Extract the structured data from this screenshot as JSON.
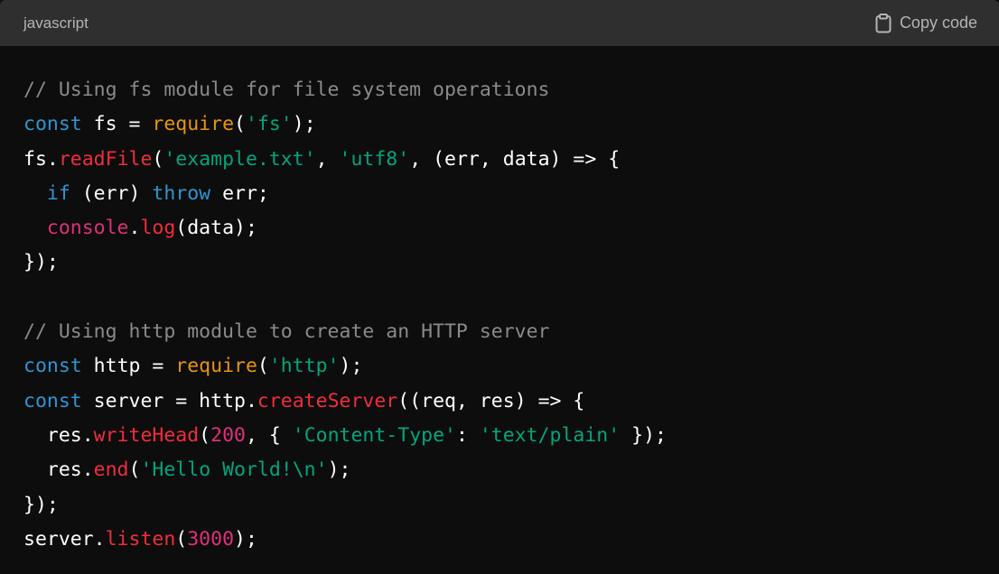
{
  "header": {
    "language": "javascript",
    "copy_label": "Copy code"
  },
  "colors": {
    "header_bg": "#2f2f2f",
    "code_bg": "#0d0d0d",
    "comment": "#8a8a8a",
    "keyword": "#2e95d3",
    "function": "#f22c3d",
    "builtin": "#e9950c",
    "string": "#00a67d",
    "number": "#df3079",
    "plain": "#ffffff"
  },
  "icons": {
    "copy": "clipboard-icon"
  },
  "code_lines": [
    [
      [
        "comment",
        "// Using fs module for file system operations"
      ]
    ],
    [
      [
        "keyword",
        "const"
      ],
      [
        "plain",
        " fs = "
      ],
      [
        "builtin",
        "require"
      ],
      [
        "plain",
        "("
      ],
      [
        "string",
        "'fs'"
      ],
      [
        "plain",
        ");"
      ]
    ],
    [
      [
        "plain",
        "fs."
      ],
      [
        "func",
        "readFile"
      ],
      [
        "plain",
        "("
      ],
      [
        "string",
        "'example.txt'"
      ],
      [
        "plain",
        ", "
      ],
      [
        "string",
        "'utf8'"
      ],
      [
        "plain",
        ", (err, data) => {"
      ]
    ],
    [
      [
        "plain",
        "  "
      ],
      [
        "keyword",
        "if"
      ],
      [
        "plain",
        " (err) "
      ],
      [
        "keyword",
        "throw"
      ],
      [
        "plain",
        " err;"
      ]
    ],
    [
      [
        "plain",
        "  "
      ],
      [
        "var",
        "console"
      ],
      [
        "plain",
        "."
      ],
      [
        "func",
        "log"
      ],
      [
        "plain",
        "(data);"
      ]
    ],
    [
      [
        "plain",
        "});"
      ]
    ],
    [
      [
        "plain",
        ""
      ]
    ],
    [
      [
        "comment",
        "// Using http module to create an HTTP server"
      ]
    ],
    [
      [
        "keyword",
        "const"
      ],
      [
        "plain",
        " http = "
      ],
      [
        "builtin",
        "require"
      ],
      [
        "plain",
        "("
      ],
      [
        "string",
        "'http'"
      ],
      [
        "plain",
        ");"
      ]
    ],
    [
      [
        "keyword",
        "const"
      ],
      [
        "plain",
        " server = http."
      ],
      [
        "func",
        "createServer"
      ],
      [
        "plain",
        "((req, res) => {"
      ]
    ],
    [
      [
        "plain",
        "  res."
      ],
      [
        "func",
        "writeHead"
      ],
      [
        "plain",
        "("
      ],
      [
        "number",
        "200"
      ],
      [
        "plain",
        ", { "
      ],
      [
        "string",
        "'Content-Type'"
      ],
      [
        "plain",
        ": "
      ],
      [
        "string",
        "'text/plain'"
      ],
      [
        "plain",
        " });"
      ]
    ],
    [
      [
        "plain",
        "  res."
      ],
      [
        "func",
        "end"
      ],
      [
        "plain",
        "("
      ],
      [
        "string",
        "'Hello World!\\n'"
      ],
      [
        "plain",
        ");"
      ]
    ],
    [
      [
        "plain",
        "});"
      ]
    ],
    [
      [
        "plain",
        "server."
      ],
      [
        "func",
        "listen"
      ],
      [
        "plain",
        "("
      ],
      [
        "number",
        "3000"
      ],
      [
        "plain",
        ");"
      ]
    ]
  ]
}
